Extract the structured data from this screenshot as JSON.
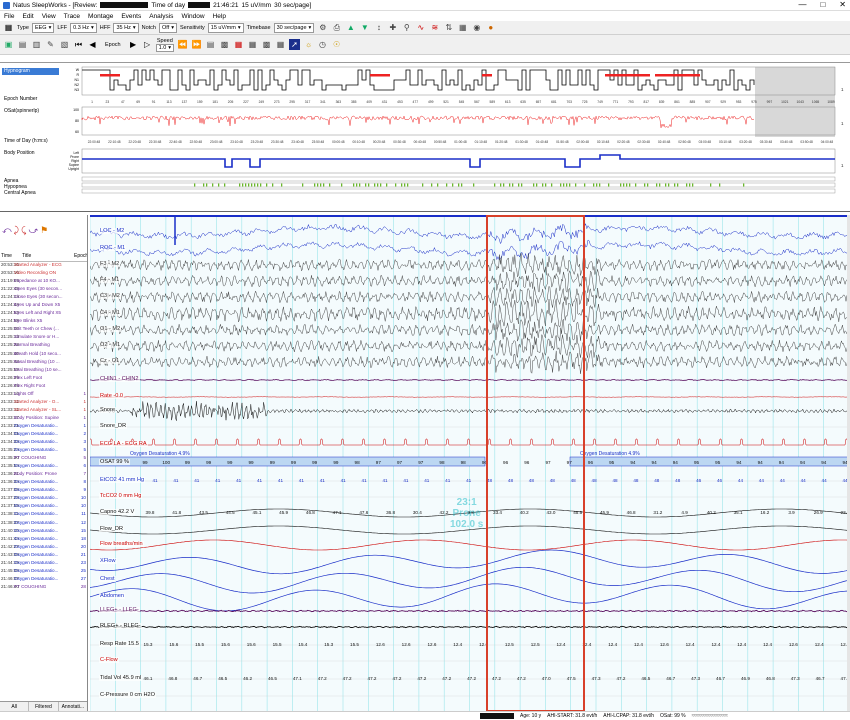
{
  "titlebar": {
    "app": "Natus SleepWorks - [Review:",
    "tod_label": "Time of day",
    "time": "21:46:21",
    "scale": "15 uV/mm",
    "timebase": "30 sec/page]"
  },
  "menu": [
    "File",
    "Edit",
    "View",
    "Trace",
    "Montage",
    "Events",
    "Analysis",
    "Window",
    "Help"
  ],
  "toolbar1": {
    "type_label": "Type",
    "type_value": "EEG",
    "lff_label": "LFF",
    "lff_value": "0.3 Hz",
    "hff_label": "HFF",
    "hff_value": "35 Hz",
    "notch_label": "Notch",
    "notch_value": "Off",
    "sens_label": "Sensitivity",
    "sens_value": "15 uV/mm",
    "tb_label": "Timebase",
    "tb_value": "30 sec/page"
  },
  "toolbar2": {
    "epoch_label": "Epoch",
    "speed_label": "Speed",
    "speed_value": "1.0"
  },
  "overview": {
    "hypnogram_label": "Hypnogram",
    "epoch_number_label": "Epoch Number",
    "spo2_label": "OSat(spinnerlp)",
    "tod_label": "Time of Day (h:m:s)",
    "body_label": "Body Position",
    "apnea_label": "Apnea",
    "hypopnea_label": "Hypopnea",
    "central_label": "Central Apnea",
    "stages": [
      "W",
      "R",
      "N1",
      "N2",
      "N3"
    ],
    "spo2_ticks": [
      "100",
      "80",
      "60"
    ],
    "body_ticks": [
      "Left",
      "Prone",
      "Right",
      "Supine",
      "Upright"
    ],
    "epoch_numbers": [
      "1",
      "23",
      "47",
      "69",
      "91",
      "113",
      "137",
      "159",
      "181",
      "205",
      "227",
      "249",
      "273",
      "295",
      "317",
      "341",
      "363",
      "385",
      "409",
      "431",
      "453",
      "477",
      "499",
      "521",
      "545",
      "567",
      "589",
      "613",
      "635",
      "657",
      "681",
      "703",
      "725",
      "749",
      "771",
      "793",
      "817",
      "839",
      "861",
      "885",
      "907",
      "929",
      "953",
      "975",
      "997",
      "1021",
      "1043",
      "1065",
      "1089"
    ],
    "times": [
      "22:00:48",
      "22:10:48",
      "22:20:48",
      "22:30:48",
      "22:40:48",
      "22:50:48",
      "23:00:48",
      "23:10:48",
      "23:20:48",
      "23:30:48",
      "23:40:48",
      "23:50:48",
      "00:00:48",
      "00:10:48",
      "00:20:48",
      "00:30:48",
      "00:40:48",
      "00:50:48",
      "01:00:48",
      "01:10:48",
      "01:20:48",
      "01:30:48",
      "01:40:48",
      "01:50:48",
      "02:00:48",
      "02:10:48",
      "02:20:48",
      "02:30:48",
      "02:40:48",
      "02:50:48",
      "03:00:48",
      "03:10:48",
      "03:20:48",
      "03:30:48",
      "03:40:48",
      "03:50:48",
      "04:00:48"
    ]
  },
  "events": {
    "col_time": "Time",
    "col_title": "Title",
    "col_epoch": "Epoch",
    "rows": [
      {
        "t": "20:53:10",
        "title": "Started Analyzer - ECG",
        "e": ""
      },
      {
        "t": "20:53:10",
        "title": "Video Recording ON",
        "e": ""
      },
      {
        "t": "21:19:08",
        "title": "Impedance at 10 KO...",
        "e": ""
      },
      {
        "t": "21:22:49",
        "title": "Open Eyes (30 secon...",
        "e": ""
      },
      {
        "t": "21:24:14",
        "title": "Close Eyes (30 secon...",
        "e": ""
      },
      {
        "t": "21:24:44",
        "title": "Eyes Up and Down X5",
        "e": ""
      },
      {
        "t": "21:24:53",
        "title": "Eyes Left and Right X5",
        "e": ""
      },
      {
        "t": "21:24:58",
        "title": "Eye Blinks X5",
        "e": ""
      },
      {
        "t": "21:25:06",
        "title": "Grit Teeth or Chew (...",
        "e": ""
      },
      {
        "t": "21:25:13",
        "title": "Simulate Snore or H...",
        "e": ""
      },
      {
        "t": "21:25:29",
        "title": "Normal Breathing",
        "e": ""
      },
      {
        "t": "21:25:40",
        "title": "Breath Hold (10 seco...",
        "e": ""
      },
      {
        "t": "21:25:48",
        "title": "Nasal Breathing (10 ...",
        "e": ""
      },
      {
        "t": "21:25:59",
        "title": "Oral Breathing (10 se...",
        "e": ""
      },
      {
        "t": "21:26:39",
        "title": "Flex Left Foot",
        "e": ""
      },
      {
        "t": "21:26:48",
        "title": "Flex Right Foot",
        "e": ""
      },
      {
        "t": "21:33:10",
        "title": "Lights Off",
        "e": "1"
      },
      {
        "t": "21:33:12",
        "title": "Started Analyzer - O...",
        "e": "1"
      },
      {
        "t": "21:33:12",
        "title": "Started Analyzer - SL...",
        "e": "1"
      },
      {
        "t": "21:33:17",
        "title": "Body Position: Supine",
        "e": "1"
      },
      {
        "t": "21:33:21",
        "title": "Oxygen Desaturatio...",
        "e": "1"
      },
      {
        "t": "21:34:01",
        "title": "Oxygen Desaturatio...",
        "e": "2"
      },
      {
        "t": "21:34:33",
        "title": "Oxygen Desaturatio...",
        "e": "3"
      },
      {
        "t": "21:35:24",
        "title": "Oxygen Desaturatio...",
        "e": "5"
      },
      {
        "t": "21:35:30",
        "title": "PT COUGHING",
        "e": "5"
      },
      {
        "t": "21:35:54",
        "title": "Oxygen Desaturatio...",
        "e": "6"
      },
      {
        "t": "21:36:21",
        "title": "Body Position: Prone",
        "e": "7"
      },
      {
        "t": "21:36:34",
        "title": "Oxygen Desaturatio...",
        "e": "8"
      },
      {
        "t": "21:37:08",
        "title": "Oxygen Desaturatio...",
        "e": "9"
      },
      {
        "t": "21:37:28",
        "title": "Oxygen Desaturatio...",
        "e": "10"
      },
      {
        "t": "21:37:55",
        "title": "Oxygen Desaturatio...",
        "e": "10"
      },
      {
        "t": "21:38:11",
        "title": "Oxygen Desaturatio...",
        "e": "11"
      },
      {
        "t": "21:38:37",
        "title": "Oxygen Desaturatio...",
        "e": "12"
      },
      {
        "t": "21:40:10",
        "title": "Oxygen Desaturatio...",
        "e": "15"
      },
      {
        "t": "21:41:44",
        "title": "Oxygen Desaturatio...",
        "e": "18"
      },
      {
        "t": "21:42:27",
        "title": "Oxygen Desaturatio...",
        "e": "20"
      },
      {
        "t": "21:43:08",
        "title": "Oxygen Desaturatio...",
        "e": "21"
      },
      {
        "t": "21:44:19",
        "title": "Oxygen Desaturatio...",
        "e": "23"
      },
      {
        "t": "21:45:08",
        "title": "Oxygen Desaturatio...",
        "e": "25"
      },
      {
        "t": "21:46:07",
        "title": "Oxygen Desaturatio...",
        "e": "27"
      },
      {
        "t": "21:46:40",
        "title": "PT COUGHING",
        "e": "28"
      }
    ],
    "tabs": [
      "All",
      "Filtered",
      "Annotati..."
    ]
  },
  "channels": [
    {
      "label": "LOC - M2",
      "color": "#1a2ec8"
    },
    {
      "label": "ROC - M1",
      "color": "#1a2ec8"
    },
    {
      "label": "F3 - M2",
      "color": "#333"
    },
    {
      "label": "F4 - M1",
      "color": "#333"
    },
    {
      "label": "C3 - M2",
      "color": "#333"
    },
    {
      "label": "C4 - M1",
      "color": "#333"
    },
    {
      "label": "O1 - M2",
      "color": "#333"
    },
    {
      "label": "O2 - M1",
      "color": "#333"
    },
    {
      "label": "Cz - O1",
      "color": "#333"
    },
    {
      "label": "CHIN1 - CHIN2",
      "color": "#5a1060"
    },
    {
      "label": "Rate -0.0",
      "color": "#c00"
    },
    {
      "label": "Snore",
      "color": "#111"
    },
    {
      "label": "Snore_DR",
      "color": "#111"
    },
    {
      "label": "ECG LA - ECG RA",
      "color": "#c00"
    },
    {
      "label": "OSAT 99 %",
      "color": "#111"
    },
    {
      "label": "EtCO2  41 mm Hg",
      "color": "#1a2ec8"
    },
    {
      "label": "TcCO2  0 mm Hg",
      "color": "#c00"
    },
    {
      "label": "Capno 42.2 V",
      "color": "#111"
    },
    {
      "label": "Flow_DR",
      "color": "#111"
    },
    {
      "label": "Flow breaths/min",
      "color": "#c00"
    },
    {
      "label": "XFlow",
      "color": "#1a2ec8"
    },
    {
      "label": "Chest",
      "color": "#1a2ec8"
    },
    {
      "label": "Abdomen",
      "color": "#1a2ec8"
    },
    {
      "label": "LLEG+ - LLEG-",
      "color": "#5a1060"
    },
    {
      "label": "RLEG+ - RLEG-",
      "color": "#111"
    },
    {
      "label": "Resp Rate 15.5",
      "color": "#111"
    },
    {
      "label": "C-Flow",
      "color": "#c00"
    },
    {
      "label": "Tidal Vol 45.9 ml",
      "color": "#111"
    },
    {
      "label": "C-Pressure   0 cm H2O",
      "color": "#111"
    }
  ],
  "desat_labels": [
    "Oxygen Desaturation 4.9%",
    "Oxygen Desaturation 4.9%"
  ],
  "osat_values": [
    "99",
    "100",
    "99",
    "99",
    "99",
    "99",
    "99",
    "99",
    "99",
    "99",
    "98",
    "97",
    "97",
    "97",
    "98",
    "98",
    "96",
    "96",
    "96",
    "97",
    "97",
    "96",
    "95",
    "94",
    "94",
    "94",
    "95",
    "95",
    "94",
    "94",
    "94",
    "94",
    "94",
    "94"
  ],
  "etco2_values": [
    "41",
    "41",
    "41",
    "41",
    "41",
    "41",
    "41",
    "41",
    "41",
    "41",
    "41",
    "41",
    "41",
    "41",
    "41",
    "41",
    "48",
    "48",
    "48",
    "48",
    "48",
    "48",
    "48",
    "48",
    "48",
    "48",
    "46",
    "46",
    "44",
    "44",
    "44",
    "44",
    "44",
    "44"
  ],
  "capno_values": [
    "39.8",
    "41.8",
    "43.5",
    "44.5",
    "45.1",
    "45.9",
    "46.8",
    "47.1",
    "47.6",
    "36.8",
    "30.4",
    "42.2",
    "3.8",
    "33.4",
    "40.2",
    "43.0",
    "45.5",
    "45.9",
    "46.8",
    "31.2",
    "4.9",
    "40.2",
    "35.1",
    "16.2",
    "3.9",
    "26.9",
    "22.2"
  ],
  "resp_values": [
    "15.3",
    "15.6",
    "15.5",
    "15.6",
    "15.6",
    "15.5",
    "15.4",
    "15.3",
    "15.5",
    "12.6",
    "12.6",
    "12.6",
    "12.4",
    "12.6",
    "12.5",
    "12.5",
    "12.4",
    "12.4",
    "12.4",
    "12.4",
    "12.6",
    "12.4",
    "12.4",
    "12.4",
    "12.4",
    "12.6",
    "12.4",
    "12.4"
  ],
  "tidal_values": [
    "46.1",
    "46.8",
    "46.7",
    "46.5",
    "46.2",
    "46.5",
    "47.1",
    "47.2",
    "47.2",
    "47.2",
    "47.2",
    "47.2",
    "47.2",
    "47.2",
    "47.2",
    "47.2",
    "47.0",
    "47.5",
    "47.3",
    "47.2",
    "46.5",
    "46.7",
    "47.3",
    "46.7",
    "46.9",
    "46.8",
    "47.3",
    "46.7",
    "47.6"
  ],
  "watermark": {
    "line1": "23:1",
    "line2": "Prone",
    "line3": "102.0 s"
  },
  "status": {
    "age": "Age: 10 y",
    "ahi_start": "AHI-START: 31.8 evt/h",
    "ahi_lcpap": "AHI-LCPAP: 31.8 evt/h",
    "osat": "OSat: 99 %"
  }
}
